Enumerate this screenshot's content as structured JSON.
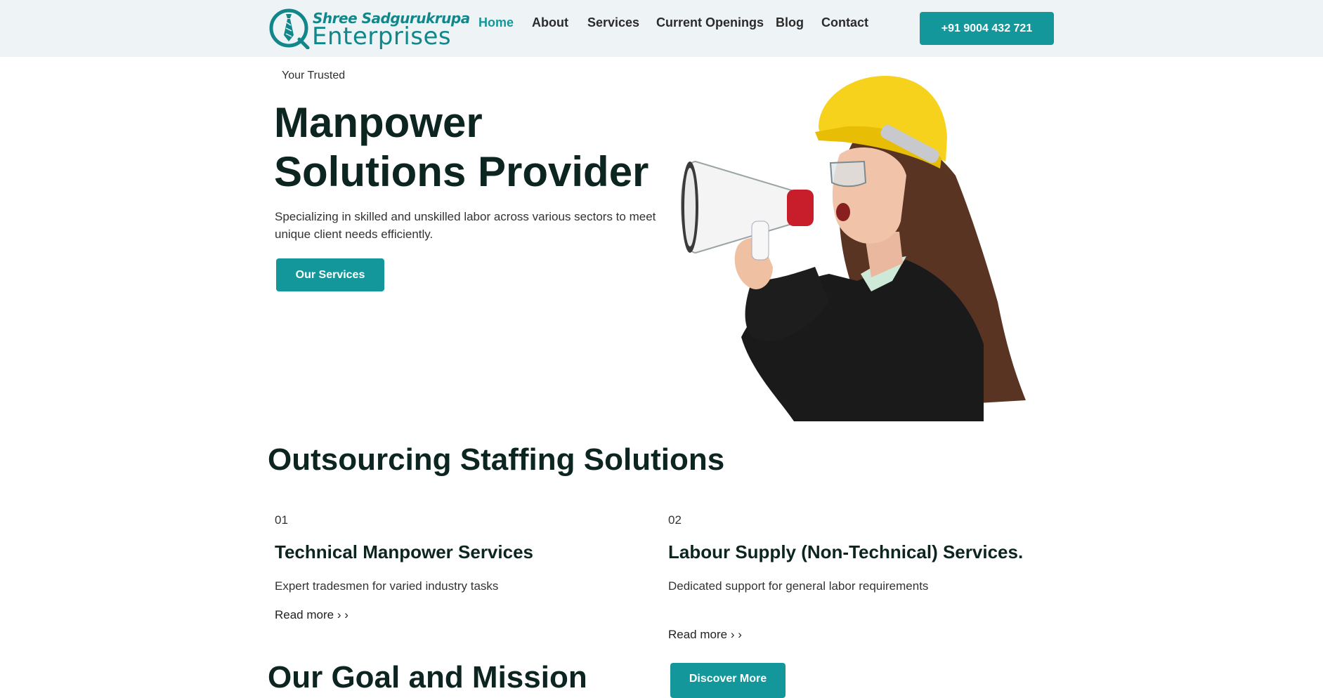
{
  "header": {
    "logo": {
      "line1": "Shree Sadgurukrupa",
      "line2": "Enterprises"
    },
    "nav": [
      {
        "label": "Home",
        "active": true
      },
      {
        "label": "About"
      },
      {
        "label": "Services"
      },
      {
        "label": "Current Openings"
      },
      {
        "label": "Blog"
      },
      {
        "label": "Contact"
      }
    ],
    "phone": "+91 9004 432 721"
  },
  "hero": {
    "eyebrow": "Your Trusted",
    "title_line1": "Manpower",
    "title_line2": "Solutions Provider",
    "description": "Specializing in skilled and unskilled labor across various sectors to meet unique client needs efficiently.",
    "cta": "Our Services",
    "image": "woman-with-megaphone-and-hard-hat"
  },
  "staffing": {
    "title": "Outsourcing Staffing Solutions",
    "cards": [
      {
        "num": "01",
        "title": "Technical Manpower Services",
        "desc": "Expert tradesmen for varied industry tasks",
        "link": "Read more › ›"
      },
      {
        "num": "02",
        "title": "Labour Supply (Non-Technical) Services.",
        "desc": "Dedicated support for general labor requirements",
        "link": "Read more › ›"
      }
    ]
  },
  "mission": {
    "title": "Our Goal and Mission",
    "cta": "Discover More"
  },
  "colors": {
    "accent": "#14979b",
    "header_bg": "#eef4f5",
    "heading": "#0d2521"
  }
}
